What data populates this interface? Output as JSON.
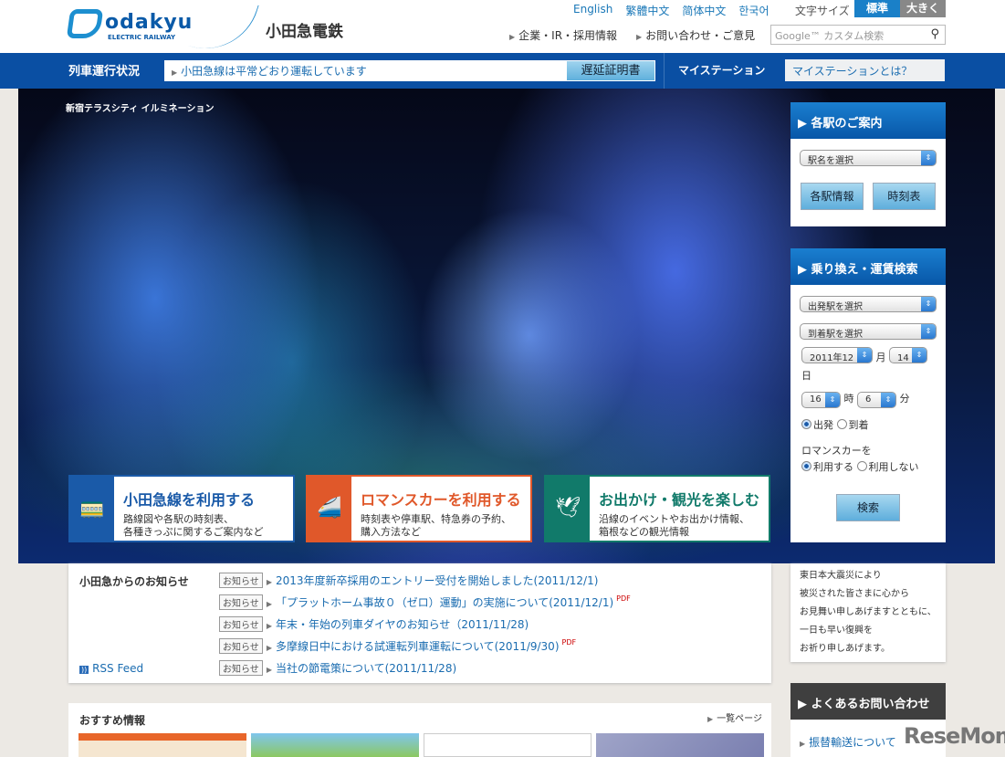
{
  "header": {
    "logo_word": "odakyu",
    "logo_sub": "ELECTRIC RAILWAY",
    "company": "小田急電鉄",
    "languages": [
      "English",
      "繁體中文",
      "简体中文",
      "한국어"
    ],
    "font_size_label": "文字サイズ",
    "font_std": "標準",
    "font_large": "大きく",
    "links": [
      "企業・IR・採用情報",
      "お問い合わせ・ご意見"
    ],
    "search_placeholder": "Google™ カスタム検索"
  },
  "status_bar": {
    "title": "列車運行状況",
    "status": "小田急線は平常どおり運転しています",
    "delay_button": "遅延証明書",
    "mystation": "マイステーション",
    "mystation_help": "マイステーションとは？"
  },
  "hero": {
    "caption": "新宿テラスシティ イルミネーション",
    "cards": [
      {
        "title": "小田急線を利用する",
        "desc1": "路線図や各駅の時刻表、",
        "desc2": "各種きっぷに関するご案内など",
        "color": "#1a5aa8"
      },
      {
        "title": "ロマンスカーを利用する",
        "desc1": "時刻表や停車駅、特急券の予約、",
        "desc2": "購入方法など",
        "color": "#e0582a"
      },
      {
        "title": "お出かけ・観光を楽しむ",
        "desc1": "沿線のイベントやお出かけ情報、",
        "desc2": "箱根などの観光情報",
        "color": "#117a6a"
      }
    ]
  },
  "station_panel": {
    "title": "各駅のご案内",
    "select": "駅名を選択",
    "btn_info": "各駅情報",
    "btn_timetable": "時刻表"
  },
  "route_panel": {
    "title": "乗り換え・運賃検索",
    "from": "出発駅を選択",
    "to": "到着駅を選択",
    "year_month": "2011年12",
    "month_label": "月",
    "day": "14",
    "day_label": "日",
    "hour": "16",
    "hour_label": "時",
    "minute": "6",
    "minute_label": "分",
    "depart": "出発",
    "arrive": "到着",
    "romancecar_label": "ロマンスカーを",
    "use": "利用する",
    "not_use": "利用しない",
    "search": "検索"
  },
  "news": {
    "title": "小田急からのお知らせ",
    "rss": "RSS Feed",
    "tag": "お知らせ",
    "pdf": "PDF",
    "items": [
      "2013年度新卒採用のエントリー受付を開始しました(2011/12/1)",
      "「プラットホーム事故０（ゼロ）運動」の実施について(2011/12/1)",
      "年末・年始の列車ダイヤのお知らせ（2011/11/28)",
      "多摩線日中における試運転列車運転について(2011/9/30)",
      "当社の節電策について(2011/11/28)"
    ]
  },
  "quake_message": [
    "東日本大震災により",
    "被災された皆さまに心から",
    "お見舞い申しあげますとともに、",
    "一日も早い復興を",
    "お祈り申しあげます。"
  ],
  "faq": {
    "title": "よくあるお問い合わせ",
    "item": "振替輸送について"
  },
  "recommend": {
    "title": "おすすめ情報",
    "list_link": "一覧ページ"
  },
  "watermark": "ReseMom"
}
